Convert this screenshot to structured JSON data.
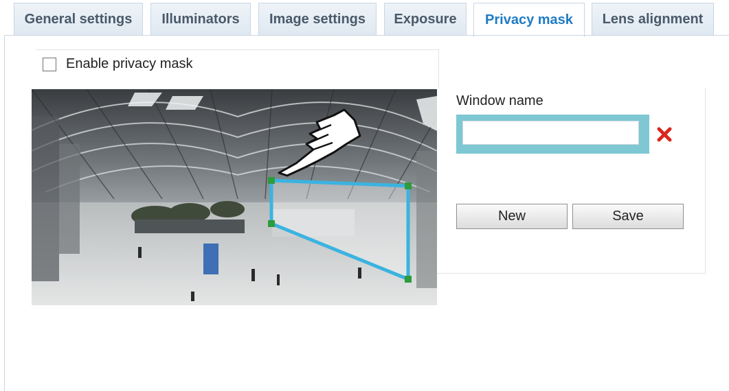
{
  "tabs": [
    {
      "label": "General settings"
    },
    {
      "label": "Illuminators"
    },
    {
      "label": "Image settings"
    },
    {
      "label": "Exposure"
    },
    {
      "label": "Privacy mask"
    },
    {
      "label": "Lens alignment"
    }
  ],
  "active_tab": "Privacy mask",
  "privacy": {
    "enable_label": "Enable privacy mask",
    "enabled": false
  },
  "window": {
    "name_label": "Window name",
    "name_value": "",
    "delete_icon": "red-x-icon",
    "mask_outline_color": "#3bb3e0",
    "mask_handle_color": "#2e9b3c"
  },
  "buttons": {
    "new_label": "New",
    "save_label": "Save"
  },
  "colors": {
    "active_tab": "#1f7bc4",
    "name_frame": "#7ec8d3",
    "delete": "#d9261c"
  }
}
